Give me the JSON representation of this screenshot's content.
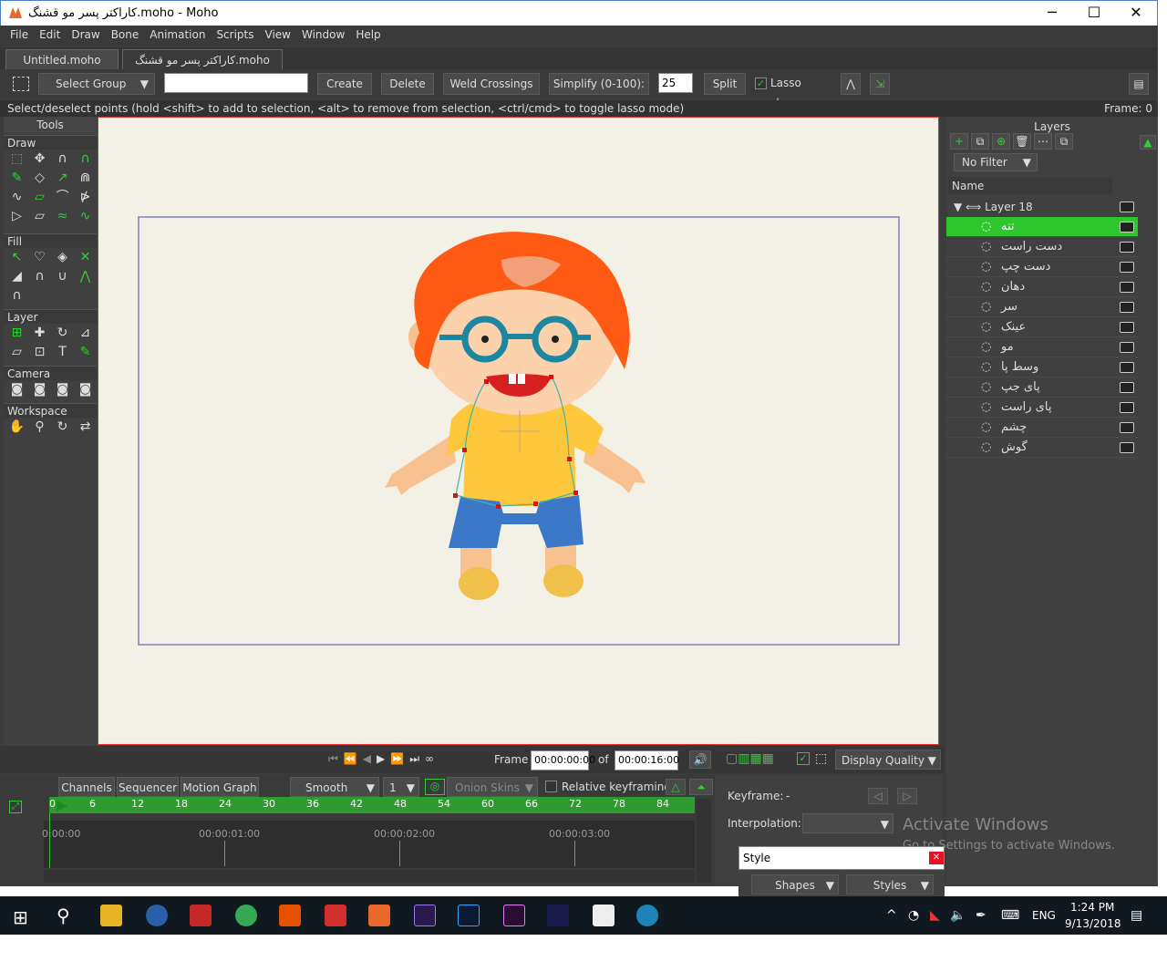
{
  "window": {
    "title": "کاراکتر پسر مو قشنگ.moho - Moho",
    "min": "─",
    "max": "☐",
    "close": "✕"
  },
  "menu": [
    "File",
    "Edit",
    "Draw",
    "Bone",
    "Animation",
    "Scripts",
    "View",
    "Window",
    "Help"
  ],
  "doc_tabs": [
    "Untitled.moho",
    "کاراکتر پسر مو قشنگ.moho"
  ],
  "toolbar": {
    "select_group": "Select Group",
    "create": "Create",
    "delete": "Delete",
    "weld": "Weld Crossings",
    "simplify": "Simplify (0-100):",
    "simplify_value": "25",
    "split": "Split",
    "lasso": "Lasso mode"
  },
  "status": {
    "hint": "Select/deselect points (hold <shift> to add to selection, <alt> to remove from selection, <ctrl/cmd> to toggle lasso mode)",
    "frame": "Frame: 0"
  },
  "tools_panel": {
    "title": "Tools",
    "sections": [
      "Draw",
      "Fill",
      "Layer",
      "Camera",
      "Workspace"
    ]
  },
  "layers_panel": {
    "title": "Layers",
    "filter": "No Filter",
    "name_col": "Name",
    "group": "Layer 18",
    "items": [
      "تنه",
      "دست راست",
      "دست چپ",
      "دهان",
      "سر",
      "عینک",
      "مو",
      "وسط پا",
      "پای جپ",
      "پای راست",
      "چشم",
      "گوش"
    ],
    "selected_index": 0
  },
  "transport": {
    "frame_label": "Frame",
    "frame_value": "00:00:00:00",
    "of": "of",
    "total": "00:00:16:00",
    "display_quality": "Display Quality"
  },
  "timeline": {
    "tabs": [
      "Channels",
      "Sequencer",
      "Motion Graph"
    ],
    "interp": "Smooth",
    "step": "1",
    "onion": "Onion Skins",
    "relative": "Relative keyframing",
    "ruler": [
      "0",
      "6",
      "12",
      "18",
      "24",
      "30",
      "36",
      "42",
      "48",
      "54",
      "60",
      "66",
      "72",
      "78",
      "84"
    ],
    "times": [
      "0:00:00",
      "00:00:01:00",
      "00:00:02:00",
      "00:00:03:00"
    ]
  },
  "keyframe_panel": {
    "keyframe_label": "Keyframe:",
    "keyframe_value": "-",
    "interpolation_label": "Interpolation:"
  },
  "style_popup": {
    "title": "Style",
    "shapes": "Shapes",
    "styles": "Styles"
  },
  "activate": {
    "line1": "Activate Windows",
    "line2": "Go to Settings to activate Windows."
  },
  "taskbar": {
    "lang": "ENG",
    "time": "1:24 PM",
    "date": "9/13/2018"
  },
  "colors": {
    "accent": "#2ec52e",
    "canvas_bg": "#f3f1e6",
    "frame_border": "#9b9bc9",
    "hair": "#ff5a14",
    "shirt": "#ffc83c",
    "pants": "#3c78c8"
  }
}
